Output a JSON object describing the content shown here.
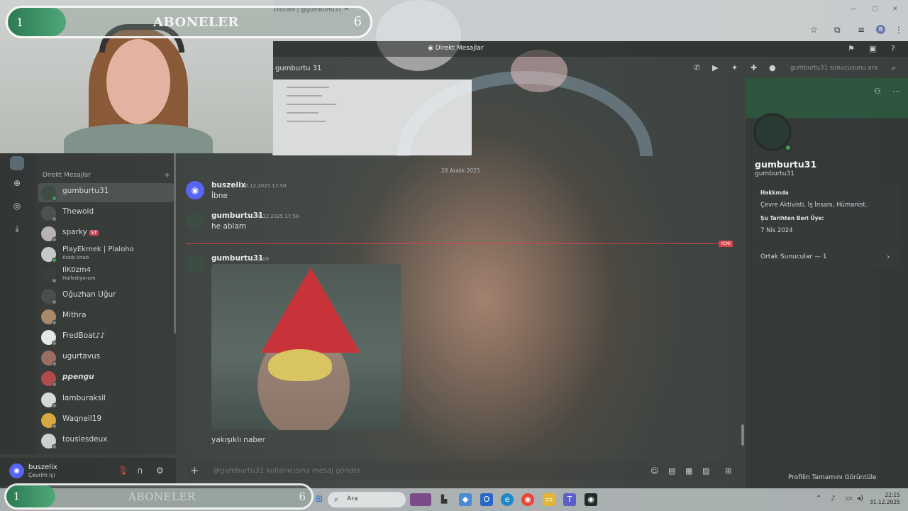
{
  "browser": {
    "tab_title": "Discord | @gumburtu31",
    "tab_close": "✕",
    "win_controls": [
      "—",
      "▢",
      "✕"
    ],
    "toolbar_icons": [
      "star-icon",
      "extensions-icon",
      "media-icon",
      "menu-icon"
    ],
    "profile_initial": "B"
  },
  "discord": {
    "window_title": "Direkt Mesajlar",
    "chat_header_name": "gumburtu 31",
    "search_placeholder": "gumburtu31 sunucusunu ara",
    "dm_header": "Direkt Mesajlar",
    "dm_plus": "+",
    "dm_list": [
      {
        "name": "gumburtu31",
        "sub": "",
        "active": true
      },
      {
        "name": "Thewoid",
        "sub": ""
      },
      {
        "name": "sparky",
        "badge": "ST",
        "sub": ""
      },
      {
        "name": "PlayEkmek | Plaloho",
        "sub": "Knob knob"
      },
      {
        "name": "IlK0zm4",
        "sub": "Halledıyorum"
      },
      {
        "name": "Oğuzhan Uğur",
        "sub": ""
      },
      {
        "name": "Mithra",
        "sub": ""
      },
      {
        "name": "FredBoat♪♪",
        "sub": ""
      },
      {
        "name": "ugurtavus",
        "sub": ""
      },
      {
        "name": "ppengu",
        "sub": ""
      },
      {
        "name": "lamburaksll",
        "sub": ""
      },
      {
        "name": "Waqneil19",
        "sub": ""
      },
      {
        "name": "touslesdeux",
        "sub": ""
      }
    ],
    "user": {
      "name": "buszelix",
      "status": "Çevrim içi"
    },
    "date_divider": "28 Aralık 2025",
    "messages": [
      {
        "author": "buszelix",
        "time": "26.12.2025 17:50",
        "text": "İbne"
      },
      {
        "author": "gumburtu31",
        "time": "26.12.2025 17:50",
        "text": "he ablam"
      },
      {
        "author": "gumburtu31",
        "time": "22:06",
        "text": "yakışıklı naber"
      }
    ],
    "new_badge": "YENİ",
    "composer_placeholder": "@gumburtu31 kullanıcısına mesaj gönder",
    "profile": {
      "name": "gumburtu31",
      "handle": "gumburtu31",
      "about_label": "Hakkında",
      "about_value": "Çevre Aktivisti, İş İnsanı, Hümanist.",
      "member_since_label": "Şu Tarihten Beri Üye:",
      "member_since_value": "7 Nis 2024",
      "mutual_servers": "Ortak Sunucular — 1",
      "view_full": "Profilin Tamamını Görüntüle"
    }
  },
  "overlay": {
    "subs_label": "ABONELER",
    "subs_current": "1",
    "subs_goal": "6",
    "subs_progress": 0.16,
    "bottom_label": "ABONELER",
    "bottom_current": "1",
    "bottom_goal": "6",
    "bottom_progress": 0.16
  },
  "taskbar": {
    "search_text": "Ara",
    "time": "22:15",
    "date": "31.12.2025"
  },
  "colors": {
    "accent_green": "#2c7a52",
    "discord_blurple": "#5865f2",
    "new_red": "#d8434b",
    "online_green": "#3ba55c"
  }
}
